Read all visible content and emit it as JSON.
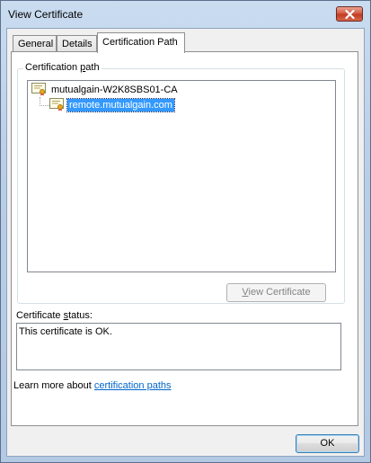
{
  "window": {
    "title": "View Certificate"
  },
  "tabs": [
    {
      "label": "General"
    },
    {
      "label": "Details"
    },
    {
      "label": "Certification Path"
    }
  ],
  "cert_path": {
    "group_label": "Certification path",
    "group_label_parts": [
      "Certification ",
      "p",
      "ath"
    ],
    "nodes": [
      {
        "label": "mutualgain-W2K8SBS01-CA"
      },
      {
        "label": "remote.mutualgain.com"
      }
    ],
    "view_button_parts": [
      "",
      "V",
      "iew Certificate"
    ]
  },
  "status": {
    "label_parts": [
      "Certificate ",
      "s",
      "tatus:"
    ],
    "text": "This certificate is OK."
  },
  "learn_more": {
    "prefix": "Learn more about ",
    "link": "certification paths"
  },
  "footer": {
    "ok_label": "OK"
  },
  "colors": {
    "selection": "#3399ff",
    "link": "#0066cc",
    "close_button": "#c0391f"
  }
}
